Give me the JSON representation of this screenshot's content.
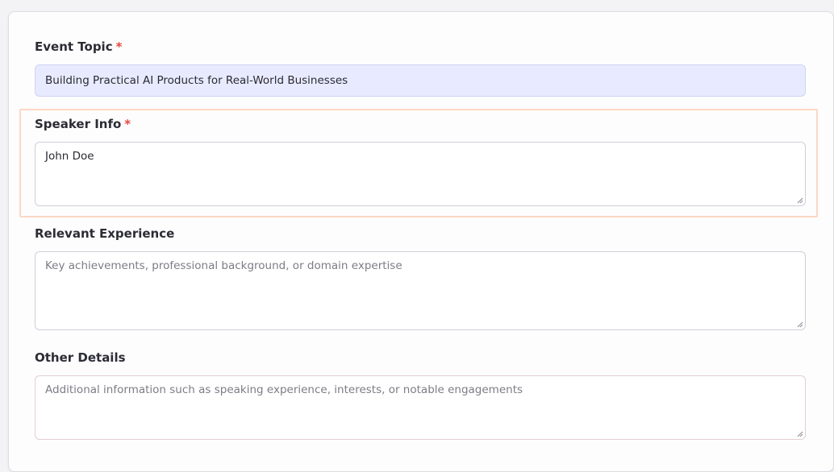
{
  "form": {
    "event_topic": {
      "label": "Event Topic",
      "required_mark": "*",
      "value": "Building Practical AI Products for Real-World Businesses"
    },
    "speaker_info": {
      "label": "Speaker Info",
      "required_mark": "*",
      "value": "John Doe"
    },
    "relevant_experience": {
      "label": "Relevant Experience",
      "value": "",
      "placeholder": "Key achievements, professional background, or domain expertise"
    },
    "other_details": {
      "label": "Other Details",
      "value": "",
      "placeholder": "Additional information such as speaking experience, interests, or notable engagements"
    }
  },
  "colors": {
    "required": "#e5483e",
    "focus_highlight": "#fdd7c3",
    "filled_input_bg": "#e8ebff"
  }
}
